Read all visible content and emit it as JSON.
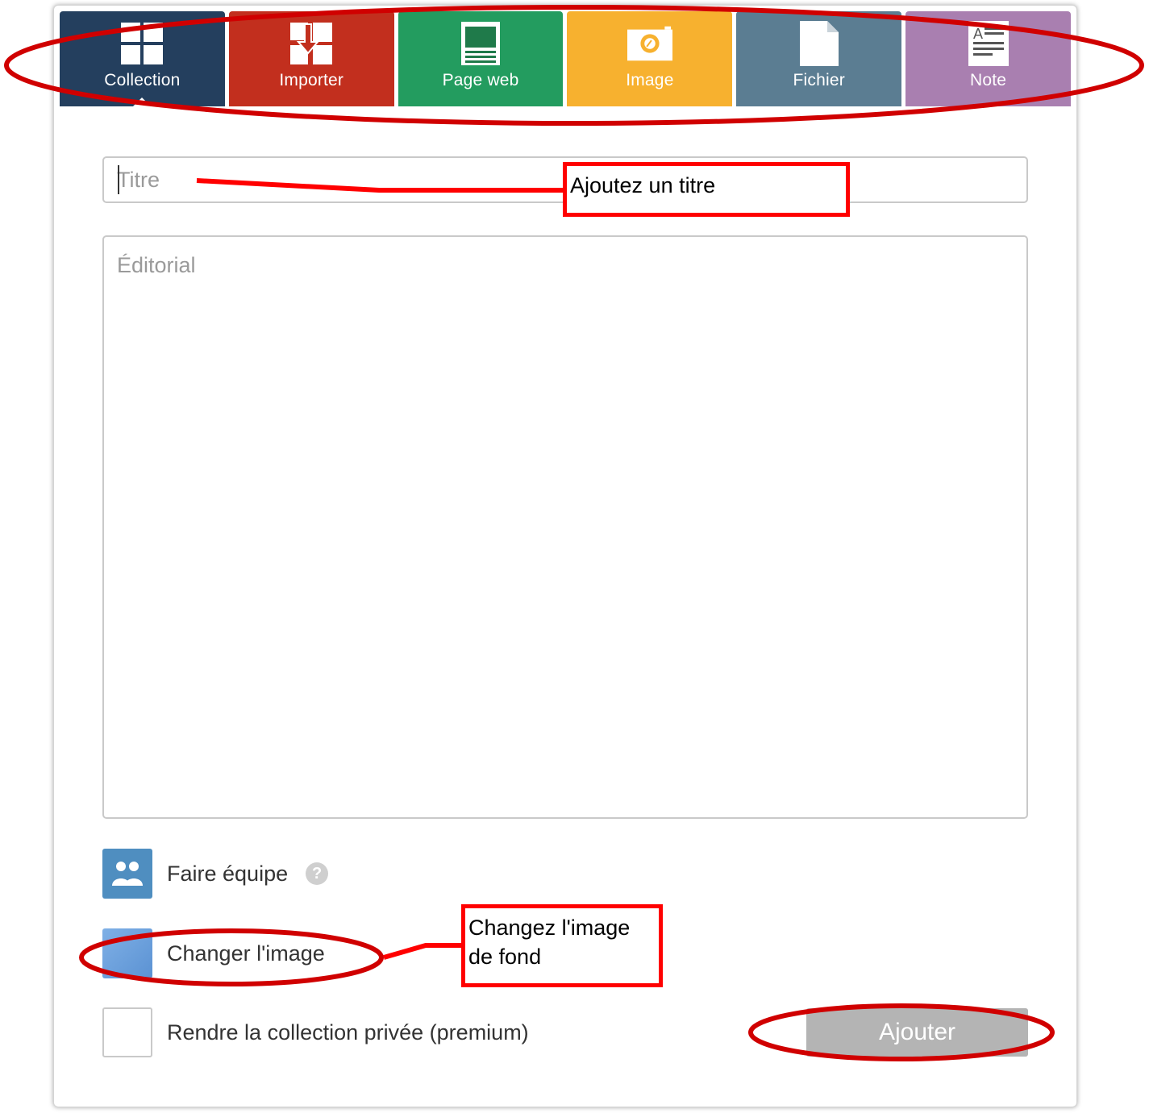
{
  "tabs": [
    {
      "label": "Collection",
      "icon": "grid-icon",
      "color": "#243f5e",
      "active": true
    },
    {
      "label": "Importer",
      "icon": "import-icon",
      "color": "#c22f1e",
      "active": false
    },
    {
      "label": "Page web",
      "icon": "webpage-icon",
      "color": "#239c5f",
      "active": false
    },
    {
      "label": "Image",
      "icon": "camera-icon",
      "color": "#f7b12f",
      "active": false
    },
    {
      "label": "Fichier",
      "icon": "file-icon",
      "color": "#5b7d92",
      "active": false
    },
    {
      "label": "Note",
      "icon": "note-icon",
      "color": "#a97fb0",
      "active": false
    }
  ],
  "form": {
    "title_placeholder": "Titre",
    "title_value": "",
    "editorial_placeholder": "Éditorial",
    "editorial_value": ""
  },
  "options": {
    "team_label": "Faire équipe",
    "team_help": "?",
    "change_image_label": "Changer l'image",
    "private_label": "Rendre la collection privée (premium)",
    "private_checked": false
  },
  "actions": {
    "add_label": "Ajouter"
  },
  "annotations": {
    "title_callout": "Ajoutez un titre",
    "image_callout": "Changez l'image de fond",
    "highlight_color": "#d00000"
  }
}
